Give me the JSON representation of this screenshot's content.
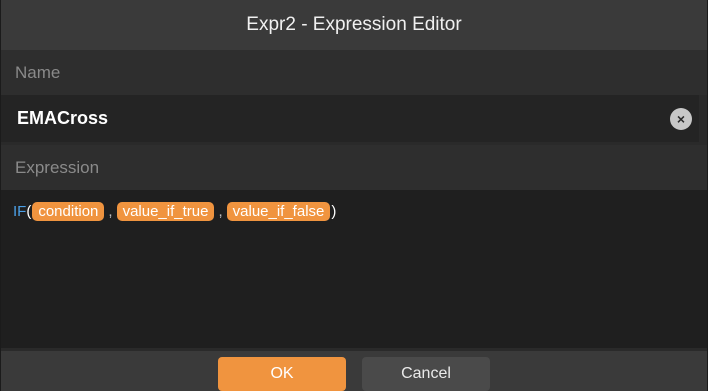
{
  "dialog": {
    "title": "Expr2 - Expression Editor",
    "name_label": "Name",
    "name_value": "EMACross",
    "expression_label": "Expression",
    "expression": {
      "function": "IF",
      "open_paren": "(",
      "close_paren": ")",
      "separator": ",",
      "params": [
        "condition",
        "value_if_true",
        "value_if_false"
      ]
    },
    "ok_label": "OK",
    "cancel_label": "Cancel",
    "clear_icon": "close-circle-icon"
  },
  "colors": {
    "accent": "#f0943f",
    "function": "#4b9fe6",
    "background": "#2a2a2a"
  }
}
